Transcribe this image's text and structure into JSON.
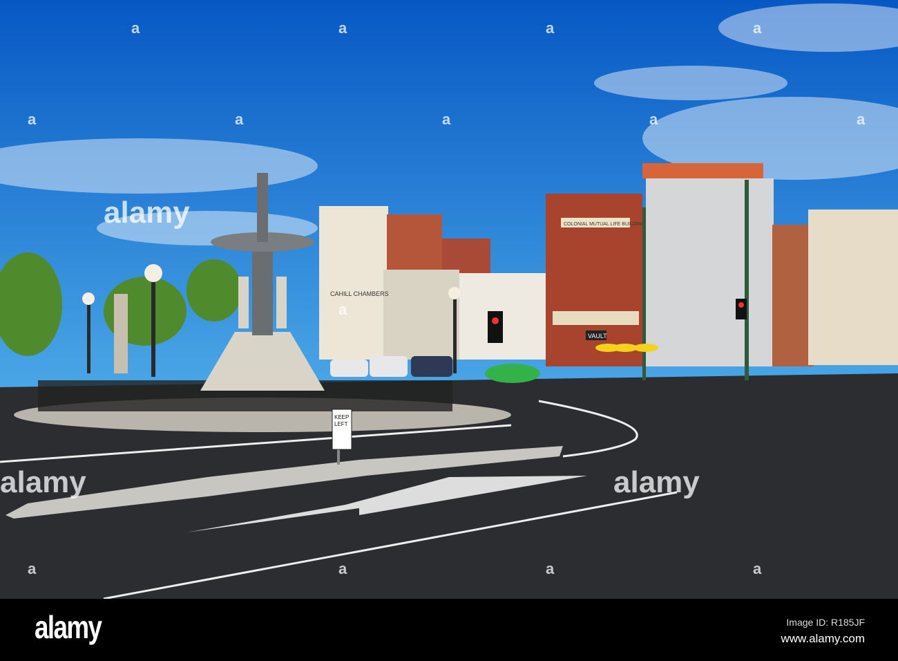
{
  "photo": {
    "signs": {
      "cahill": "CAHILL CHAMBERS",
      "colonial": "COLONIAL MUTUAL LIFE BUILDING",
      "vault": "VAULT",
      "keep_left_1": "KEEP",
      "keep_left_2": "LEFT"
    },
    "watermark": {
      "word": "alamy",
      "mark": "a"
    }
  },
  "footer": {
    "brand": "alamy",
    "image_id": "Image ID: R185JF",
    "url": "www.alamy.com"
  },
  "colors": {
    "sky_top": "#0a5fc8",
    "sky_bottom": "#3a9be0",
    "road": "#2b2d30",
    "brick": "#a8442e"
  }
}
